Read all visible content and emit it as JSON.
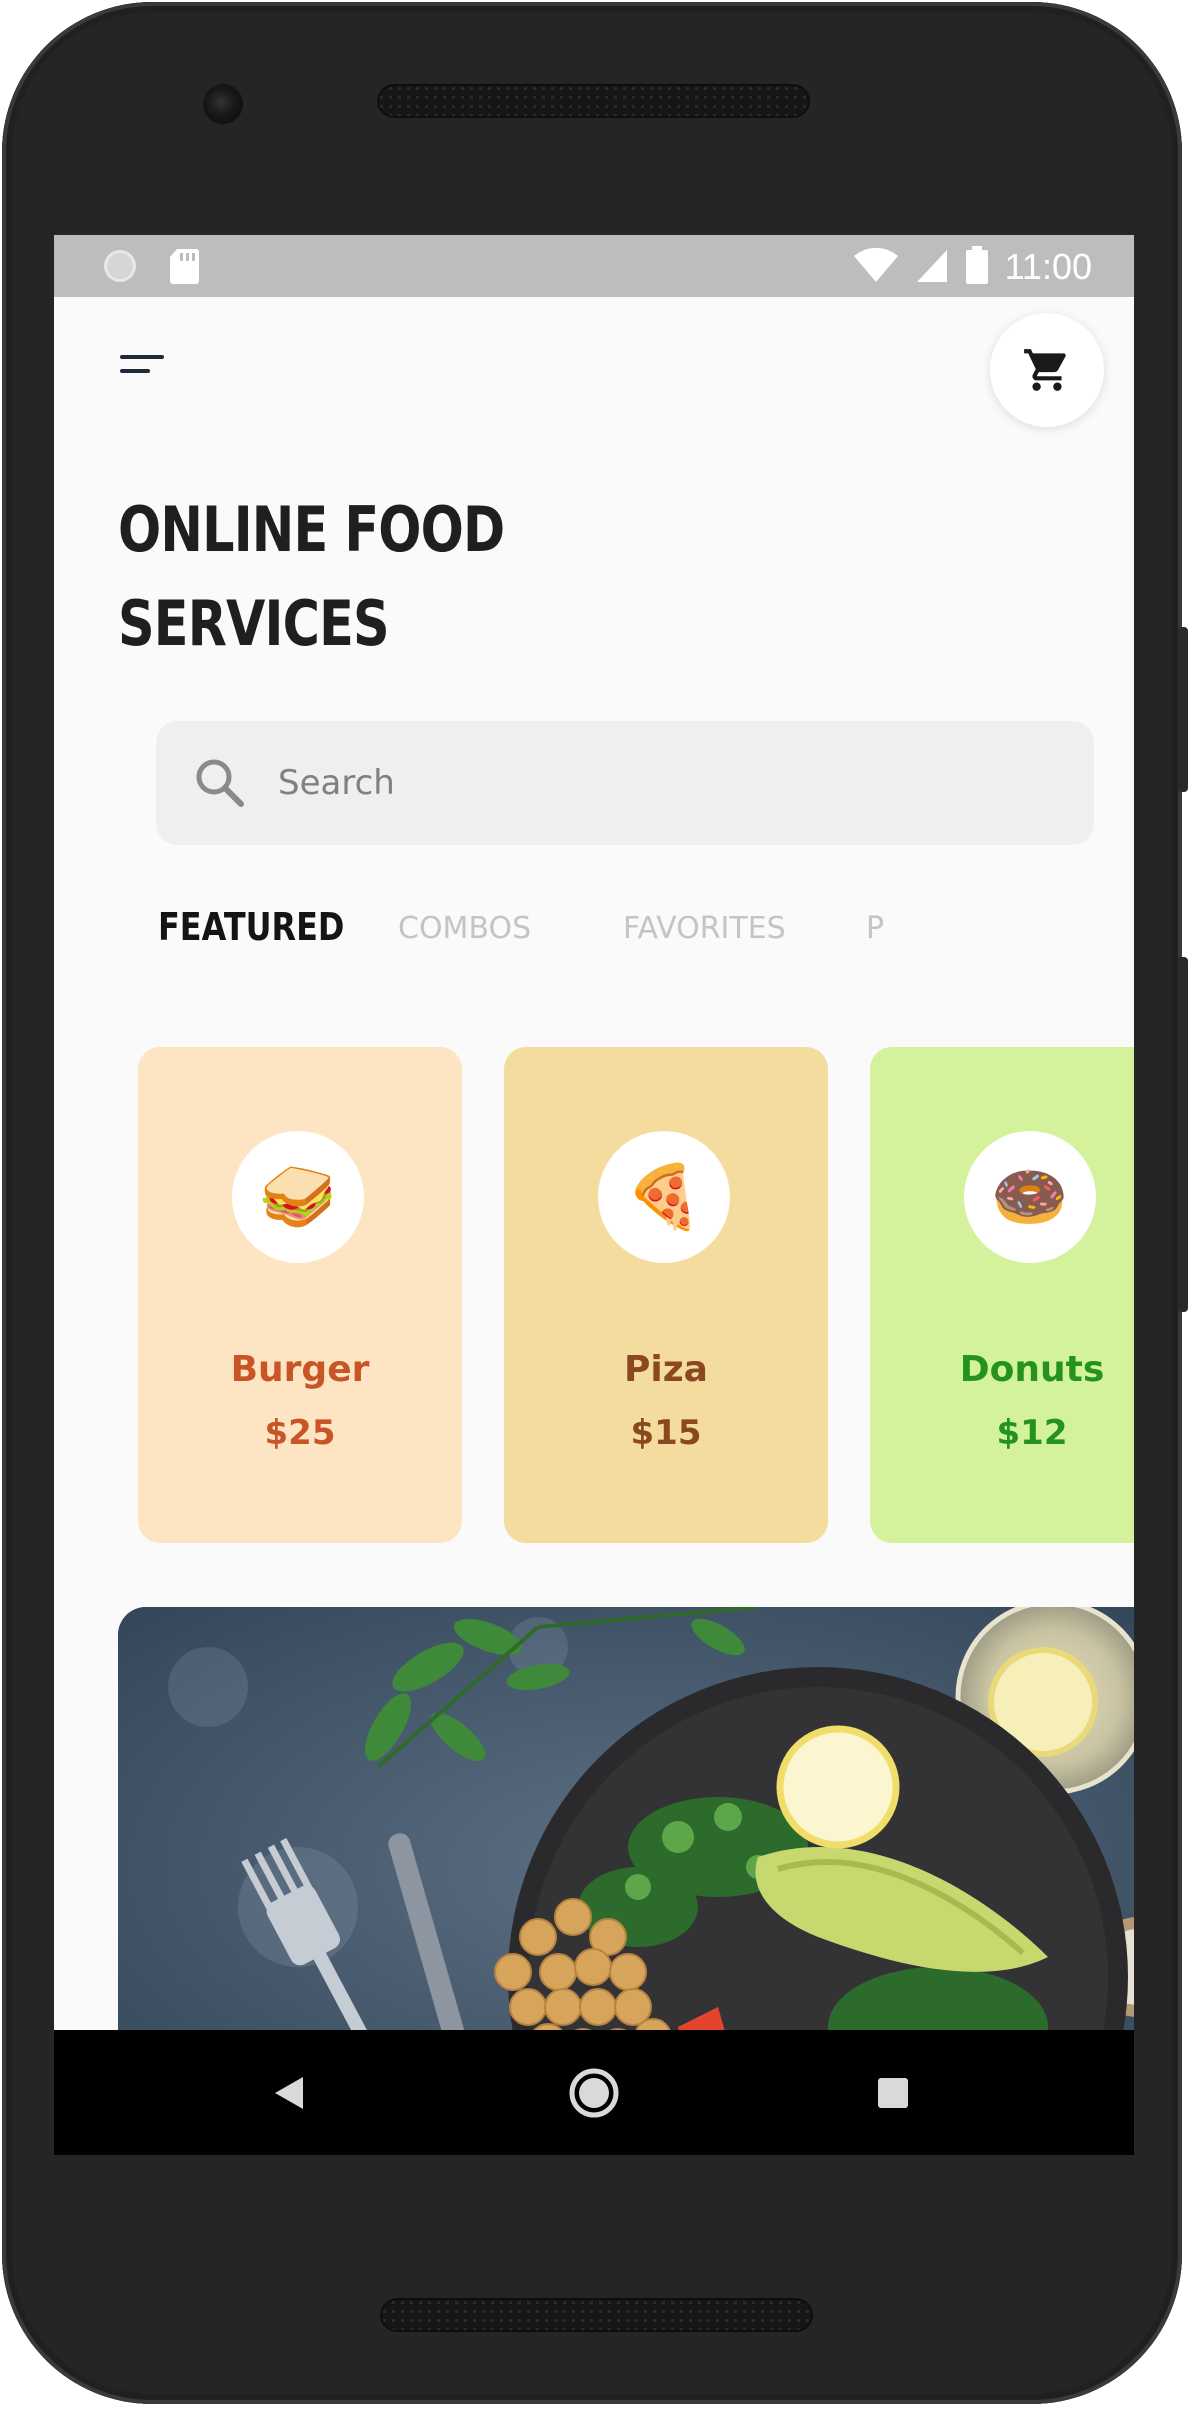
{
  "status_bar": {
    "time": "11:00",
    "left_icons": [
      "status-circle-icon",
      "sd-card-icon"
    ],
    "right_icons": [
      "wifi-icon",
      "signal-icon",
      "battery-icon"
    ]
  },
  "header": {
    "menu_icon": "hamburger-menu-icon",
    "cart_icon": "cart-icon",
    "title_line1": "ONLINE FOOD",
    "title_line2": "SERVICES"
  },
  "search": {
    "placeholder": "Search",
    "value": "",
    "icon": "search-icon"
  },
  "tabs": [
    {
      "label": "FEATURED",
      "active": true
    },
    {
      "label": "COMBOS",
      "active": false
    },
    {
      "label": "FAVORITES",
      "active": false
    },
    {
      "label": "P",
      "active": false
    }
  ],
  "cards": [
    {
      "name": "Burger",
      "price": "$25",
      "emoji": "🥪",
      "bg": "#fde5c4",
      "text_color": "#c85526"
    },
    {
      "name": "Piza",
      "price": "$15",
      "emoji": "🍕",
      "bg": "#f4dc9f",
      "text_color": "#8b4720"
    },
    {
      "name": "Donuts",
      "price": "$12",
      "emoji": "🍩",
      "bg": "#d4f29b",
      "text_color": "#23931b"
    }
  ],
  "nav_bar": {
    "back_icon": "back-triangle-icon",
    "home_icon": "home-circle-icon",
    "recents_icon": "recents-square-icon"
  },
  "colors": {
    "screen_bg": "#fafafa",
    "status_bar_bg": "#bdbdbd",
    "title_color": "#1f1f1f",
    "search_bg": "#efefef"
  }
}
